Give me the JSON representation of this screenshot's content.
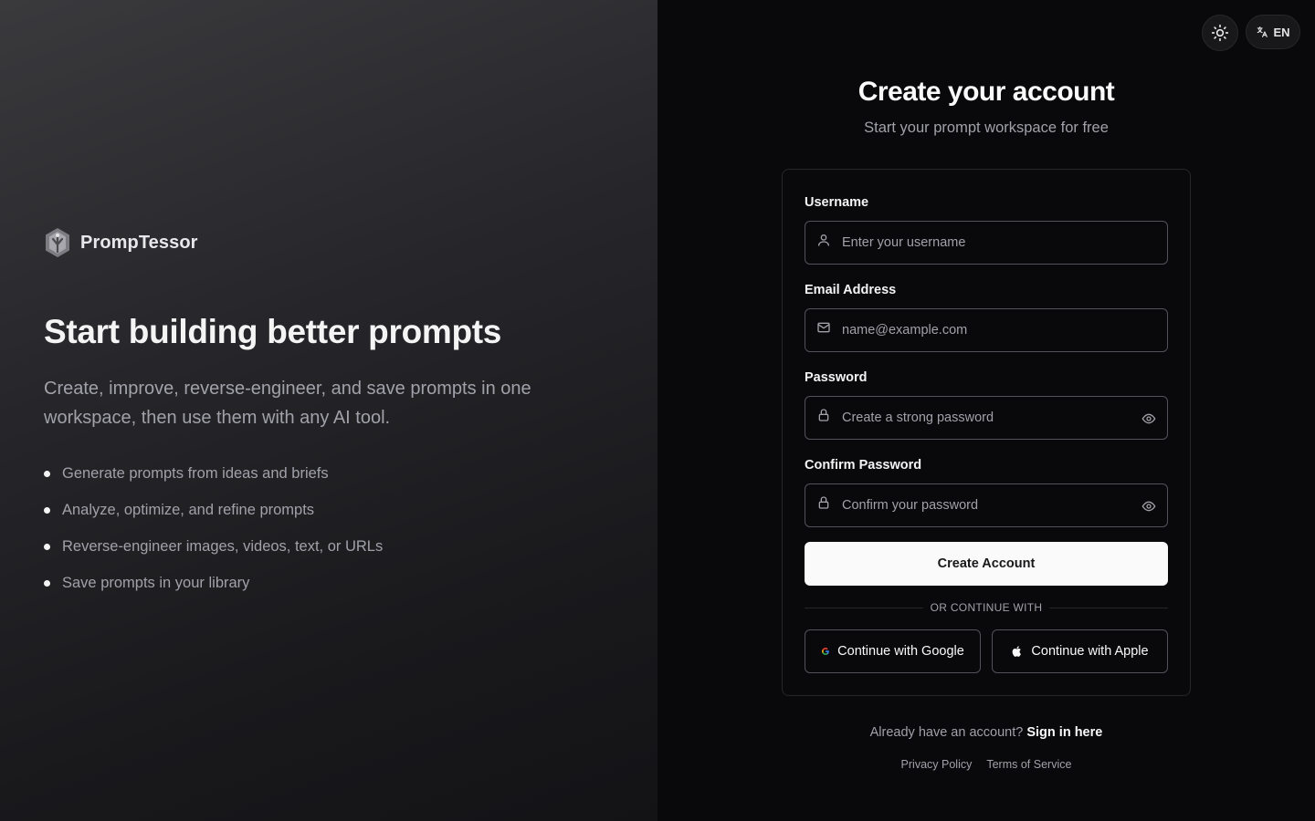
{
  "hero": {
    "brand_name": "PrompTessor",
    "title": "Start building better prompts",
    "description": "Create, improve, reverse-engineer, and save prompts in one workspace, then use them with any AI tool.",
    "features": [
      "Generate prompts from ideas and briefs",
      "Analyze, optimize, and refine prompts",
      "Reverse-engineer images, videos, text, or URLs",
      "Save prompts in your library"
    ]
  },
  "header": {
    "theme_toggle_icon": "sun-icon",
    "language_icon": "translate-icon",
    "language_label": "EN"
  },
  "form": {
    "title": "Create your account",
    "subtitle": "Start your prompt workspace for free",
    "fields": {
      "username": {
        "label": "Username",
        "placeholder": "Enter your username",
        "value": "",
        "icon": "user-icon"
      },
      "email": {
        "label": "Email Address",
        "placeholder": "name@example.com",
        "value": "",
        "icon": "mail-icon"
      },
      "password": {
        "label": "Password",
        "placeholder": "Create a strong password",
        "value": "",
        "icon": "lock-icon"
      },
      "confirm_password": {
        "label": "Confirm Password",
        "placeholder": "Confirm your password",
        "value": "",
        "icon": "lock-icon"
      }
    },
    "submit_label": "Create Account",
    "divider_text": "OR CONTINUE WITH",
    "google_label": "Continue with Google",
    "apple_label": "Continue with Apple"
  },
  "footer": {
    "signin_prompt": "Already have an account?",
    "signin_link": "Sign in here",
    "privacy": "Privacy Policy",
    "terms": "Terms of Service"
  },
  "colors": {
    "background": "#09090b",
    "card_border": "#27272a",
    "input_border": "#52525b",
    "primary_button": "#fafafa",
    "muted_text": "#a1a1aa"
  }
}
